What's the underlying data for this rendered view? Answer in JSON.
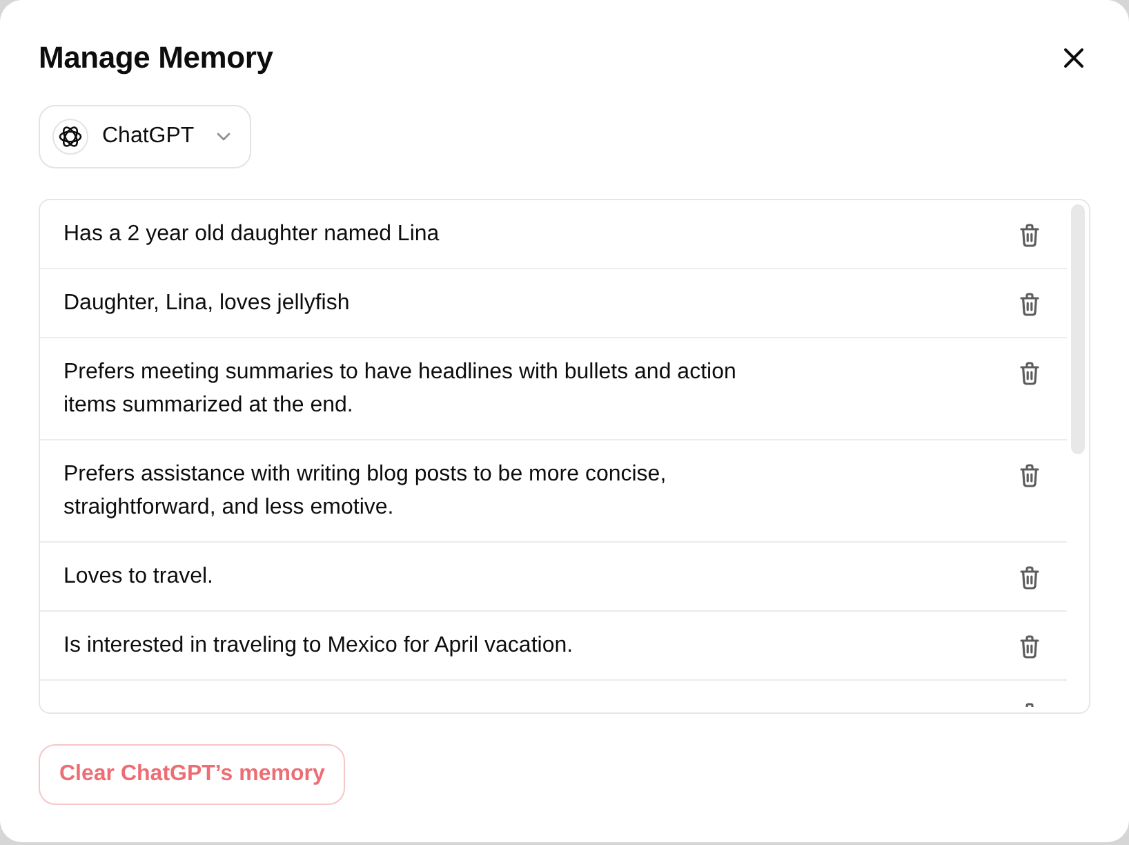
{
  "dialog": {
    "title": "Manage Memory"
  },
  "model_selector": {
    "label": "ChatGPT"
  },
  "memories": [
    {
      "text": "Has a 2 year old daughter named Lina"
    },
    {
      "text": "Daughter, Lina, loves jellyfish"
    },
    {
      "text": "Prefers meeting summaries to have headlines with bullets and action items summarized at the end."
    },
    {
      "text": "Prefers assistance with writing blog posts to be more concise, straightforward, and less emotive."
    },
    {
      "text": "Loves to travel."
    },
    {
      "text": "Is interested in traveling to Mexico for April vacation."
    }
  ],
  "more_below": true,
  "clear_button": {
    "label": "Clear ChatGPT’s memory"
  }
}
